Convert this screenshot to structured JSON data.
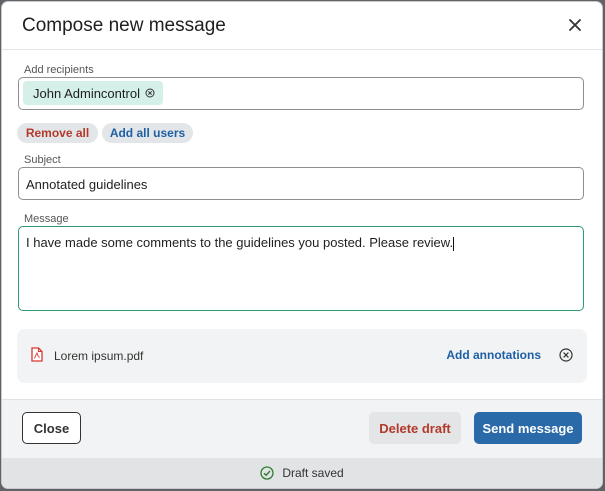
{
  "background_text": "",
  "dialog": {
    "title": "Compose new message",
    "close_icon": "close-icon"
  },
  "recipients": {
    "label": "Add recipients",
    "chips": [
      {
        "name": "John Admincontrol",
        "remove_icon": "remove-circle-icon"
      }
    ],
    "remove_all_label": "Remove all",
    "add_all_label": "Add all users"
  },
  "subject": {
    "label": "Subject",
    "value": "Annotated guidelines"
  },
  "message": {
    "label": "Message",
    "value": "I have made some comments to the guidelines you posted. Please review."
  },
  "attachment": {
    "file_icon": "pdf-file-icon",
    "filename": "Lorem ipsum.pdf",
    "add_annotations_label": "Add annotations",
    "remove_icon": "remove-circle-icon"
  },
  "footer": {
    "close_label": "Close",
    "delete_draft_label": "Delete draft",
    "send_label": "Send message"
  },
  "status": {
    "icon": "check-circle-icon",
    "text": "Draft saved"
  },
  "colors": {
    "accent_blue": "#1f5fa5",
    "danger_red": "#b23a2a",
    "focus_green": "#2e9a6e",
    "chip_bg": "#d4f0e9",
    "pdf_red": "#d43a2f"
  }
}
